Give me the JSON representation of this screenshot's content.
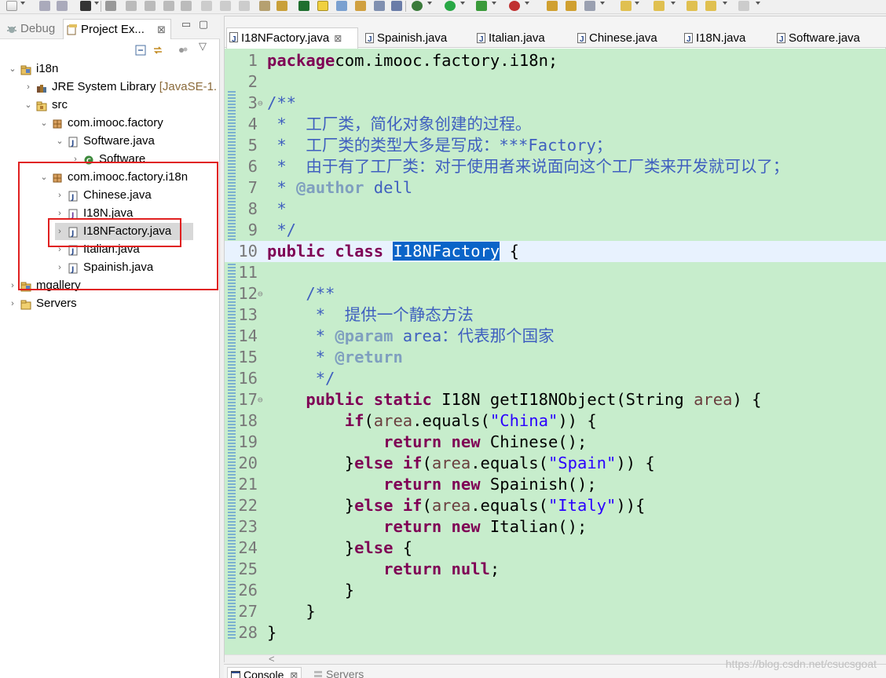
{
  "left_panel": {
    "tabs": {
      "debug": "Debug",
      "project": "Project Ex..."
    },
    "close_glyph": "⊠",
    "minimize_glyph": "▭",
    "maximize_glyph": "▢",
    "tree": [
      {
        "label": "i18n",
        "indent": 0,
        "toggle": "v",
        "icon": "project-icon"
      },
      {
        "label": "JRE System Library",
        "suffix": "[JavaSE-1.",
        "indent": 1,
        "toggle": ">",
        "icon": "library-icon"
      },
      {
        "label": "src",
        "indent": 1,
        "toggle": "v",
        "icon": "source-folder-icon"
      },
      {
        "label": "com.imooc.factory",
        "indent": 2,
        "toggle": "v",
        "icon": "package-icon"
      },
      {
        "label": "Software.java",
        "indent": 3,
        "toggle": "v",
        "icon": "java-file-icon"
      },
      {
        "label": "Software",
        "indent": 4,
        "toggle": ">",
        "icon": "class-icon"
      },
      {
        "label": "com.imooc.factory.i18n",
        "indent": 2,
        "toggle": "v",
        "icon": "package-icon"
      },
      {
        "label": "Chinese.java",
        "indent": 3,
        "toggle": ">",
        "icon": "java-file-icon"
      },
      {
        "label": "I18N.java",
        "indent": 3,
        "toggle": ">",
        "icon": "java-interface-file-icon"
      },
      {
        "label": "I18NFactory.java",
        "indent": 3,
        "toggle": ">",
        "icon": "java-file-icon",
        "selected": true
      },
      {
        "label": "Italian.java",
        "indent": 3,
        "toggle": ">",
        "icon": "java-file-icon"
      },
      {
        "label": "Spainish.java",
        "indent": 3,
        "toggle": ">",
        "icon": "java-file-icon"
      },
      {
        "label": "mgallery",
        "indent": 0,
        "toggle": ">",
        "icon": "project-icon"
      },
      {
        "label": "Servers",
        "indent": 0,
        "toggle": ">",
        "icon": "folder-icon"
      }
    ]
  },
  "editor": {
    "tabs": [
      {
        "label": "I18NFactory.java",
        "active": true
      },
      {
        "label": "Spainish.java"
      },
      {
        "label": "Italian.java"
      },
      {
        "label": "Chinese.java"
      },
      {
        "label": "I18N.java"
      },
      {
        "label": "Software.java"
      }
    ],
    "tab_close_glyph": "⊠",
    "lines": [
      {
        "n": "1",
        "tokens": [
          [
            "kw",
            "package"
          ],
          [
            "",
            "com.imooc.factory.i18n;"
          ]
        ]
      },
      {
        "n": "2",
        "tokens": []
      },
      {
        "n": "3",
        "fold": "⊖",
        "tokens": [
          [
            "cm",
            "/**"
          ]
        ]
      },
      {
        "n": "4",
        "tokens": [
          [
            "cm",
            " *  工厂类，简化对象创建的过程。"
          ]
        ]
      },
      {
        "n": "5",
        "tokens": [
          [
            "cm",
            " *  工厂类的类型大多是写成：***Factory；"
          ]
        ]
      },
      {
        "n": "6",
        "tokens": [
          [
            "cm",
            " *  由于有了工厂类：对于使用者来说面向这个工厂类来开发就可以了；"
          ]
        ]
      },
      {
        "n": "7",
        "tokens": [
          [
            "cm",
            " * "
          ],
          [
            "doctag",
            "@author"
          ],
          [
            "cm",
            " dell"
          ]
        ]
      },
      {
        "n": "8",
        "tokens": [
          [
            "cm",
            " *"
          ]
        ]
      },
      {
        "n": "9",
        "tokens": [
          [
            "cm",
            " */"
          ]
        ]
      },
      {
        "n": "10",
        "highlight": true,
        "tokens": [
          [
            "kw",
            "public"
          ],
          [
            "",
            " "
          ],
          [
            "kw",
            "class"
          ],
          [
            "",
            " "
          ],
          [
            "sel",
            "I18NFactory"
          ],
          [
            "",
            " {"
          ]
        ]
      },
      {
        "n": "11",
        "tokens": []
      },
      {
        "n": "12",
        "fold": "⊖",
        "tokens": [
          [
            "",
            "    "
          ],
          [
            "cm",
            "/**"
          ]
        ]
      },
      {
        "n": "13",
        "tokens": [
          [
            "cm",
            "     *  提供一个静态方法"
          ]
        ]
      },
      {
        "n": "14",
        "tokens": [
          [
            "cm",
            "     * "
          ],
          [
            "doctag",
            "@param"
          ],
          [
            "cm",
            " area：代表那个国家"
          ]
        ]
      },
      {
        "n": "15",
        "tokens": [
          [
            "cm",
            "     * "
          ],
          [
            "doctag",
            "@return"
          ]
        ]
      },
      {
        "n": "16",
        "tokens": [
          [
            "cm",
            "     */"
          ]
        ]
      },
      {
        "n": "17",
        "fold": "⊖",
        "tokens": [
          [
            "",
            "    "
          ],
          [
            "kw",
            "public"
          ],
          [
            "",
            " "
          ],
          [
            "kw",
            "static"
          ],
          [
            "",
            " I18N getI18NObject(String "
          ],
          [
            "var",
            "area"
          ],
          [
            "",
            ") {"
          ]
        ]
      },
      {
        "n": "18",
        "tokens": [
          [
            "",
            "        "
          ],
          [
            "kw",
            "if"
          ],
          [
            "",
            "("
          ],
          [
            "var",
            "area"
          ],
          [
            "",
            ".equals("
          ],
          [
            "str",
            "\"China\""
          ],
          [
            "",
            ")) {"
          ]
        ]
      },
      {
        "n": "19",
        "tokens": [
          [
            "",
            "            "
          ],
          [
            "kw",
            "return"
          ],
          [
            "",
            " "
          ],
          [
            "kw",
            "new"
          ],
          [
            "",
            " Chinese();"
          ]
        ]
      },
      {
        "n": "20",
        "tokens": [
          [
            "",
            "        }"
          ],
          [
            "kw",
            "else"
          ],
          [
            "",
            " "
          ],
          [
            "kw",
            "if"
          ],
          [
            "",
            "("
          ],
          [
            "var",
            "area"
          ],
          [
            "",
            ".equals("
          ],
          [
            "str",
            "\"Spain\""
          ],
          [
            "",
            ")) {"
          ]
        ]
      },
      {
        "n": "21",
        "tokens": [
          [
            "",
            "            "
          ],
          [
            "kw",
            "return"
          ],
          [
            "",
            " "
          ],
          [
            "kw",
            "new"
          ],
          [
            "",
            " Spainish();"
          ]
        ]
      },
      {
        "n": "22",
        "tokens": [
          [
            "",
            "        }"
          ],
          [
            "kw",
            "else"
          ],
          [
            "",
            " "
          ],
          [
            "kw",
            "if"
          ],
          [
            "",
            "("
          ],
          [
            "var",
            "area"
          ],
          [
            "",
            ".equals("
          ],
          [
            "str",
            "\"Italy\""
          ],
          [
            "",
            ")){"
          ]
        ]
      },
      {
        "n": "23",
        "tokens": [
          [
            "",
            "            "
          ],
          [
            "kw",
            "return"
          ],
          [
            "",
            " "
          ],
          [
            "kw",
            "new"
          ],
          [
            "",
            " Italian();"
          ]
        ]
      },
      {
        "n": "24",
        "tokens": [
          [
            "",
            "        }"
          ],
          [
            "kw",
            "else"
          ],
          [
            "",
            " {"
          ]
        ]
      },
      {
        "n": "25",
        "tokens": [
          [
            "",
            "            "
          ],
          [
            "kw",
            "return"
          ],
          [
            "",
            " "
          ],
          [
            "kw",
            "null"
          ],
          [
            "",
            ";"
          ]
        ]
      },
      {
        "n": "26",
        "tokens": [
          [
            "",
            "        }"
          ]
        ]
      },
      {
        "n": "27",
        "tokens": [
          [
            "",
            "    }"
          ]
        ]
      },
      {
        "n": "28",
        "tokens": [
          [
            "",
            "}"
          ]
        ]
      }
    ],
    "scroll_left_glyph": "<"
  },
  "bottom": {
    "tabs": {
      "console": "Console",
      "servers": "Servers"
    },
    "close_glyph": "⊠"
  },
  "watermark": "https://blog.csdn.net/csucsgoat",
  "colors": {
    "editor_background": "#c7edcc",
    "keyword": "#7f0055",
    "comment": "#3f5fbf",
    "string": "#2a00ff",
    "selection": "#0a64c8",
    "highlight_box": "#e02020"
  }
}
